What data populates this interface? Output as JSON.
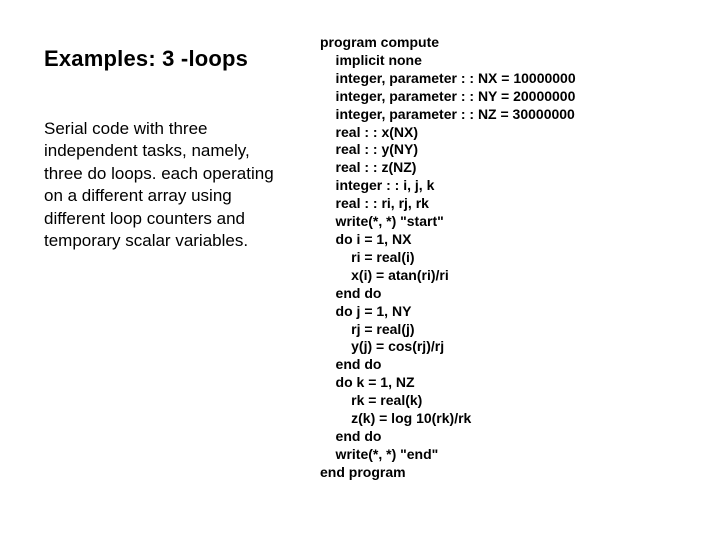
{
  "left": {
    "title": "Examples: 3 -loops",
    "description": "Serial code with three independent tasks, namely, three do loops. each operating on a different array using different loop counters and temporary scalar variables."
  },
  "code": {
    "lines": [
      "program compute",
      "    implicit none",
      "    integer, parameter : : NX = 10000000",
      "    integer, parameter : : NY = 20000000",
      "    integer, parameter : : NZ = 30000000",
      "    real : : x(NX)",
      "    real : : y(NY)",
      "    real : : z(NZ)",
      "    integer : : i, j, k",
      "    real : : ri, rj, rk",
      "    write(*, *) \"start\"",
      "    do i = 1, NX",
      "        ri = real(i)",
      "        x(i) = atan(ri)/ri",
      "    end do",
      "    do j = 1, NY",
      "        rj = real(j)",
      "        y(j) = cos(rj)/rj",
      "    end do",
      "    do k = 1, NZ",
      "        rk = real(k)",
      "        z(k) = log 10(rk)/rk",
      "    end do",
      "    write(*, *) \"end\"",
      "end program"
    ]
  }
}
